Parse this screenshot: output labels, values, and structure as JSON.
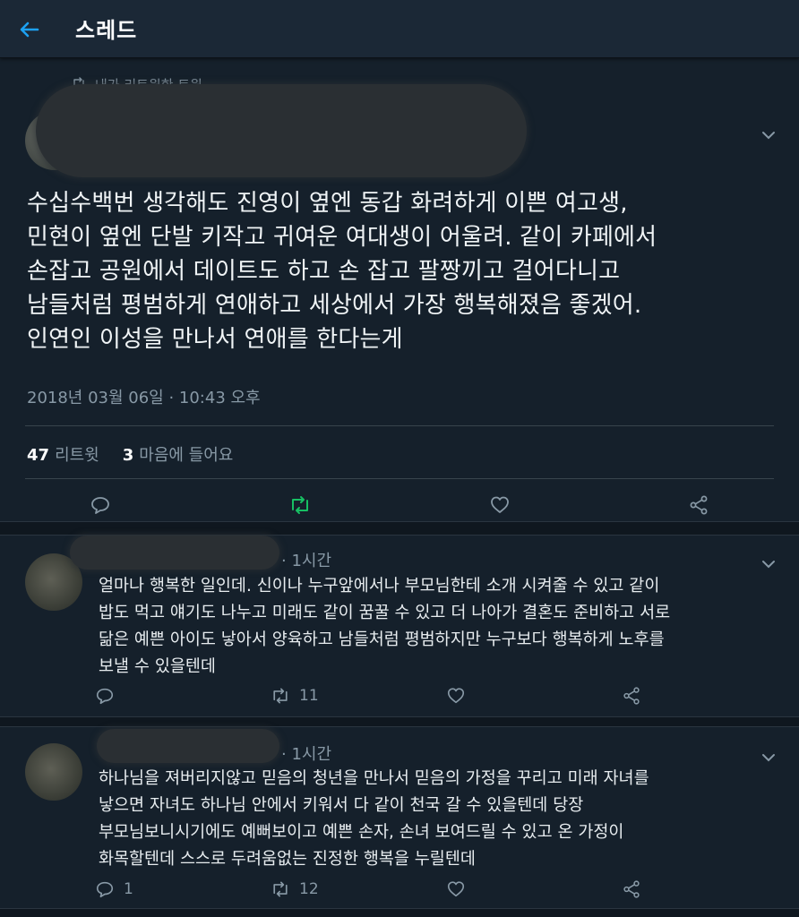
{
  "header": {
    "title": "스레드"
  },
  "retweet_note": "내가 리트윗한 트윗",
  "tweet": {
    "text": "수십수백번 생각해도 진영이 옆엔 동갑 화려하게 이쁜 여고생,\n민현이 옆엔 단발 키작고 귀여운 여대생이 어울려. 같이 카페에서\n손잡고 공원에서 데이트도 하고 손 잡고 팔짱끼고 걸어다니고\n남들처럼 평범하게 연애하고 세상에서 가장 행복해졌음 좋겠어.\n인연인 이성을 만나서 연애를 한다는게",
    "timestamp": "2018년 03월 06일 · 10:43 오후",
    "retweet_count": "47",
    "retweet_label": "리트윗",
    "like_count": "3",
    "like_label": "마음에 들어요"
  },
  "replies": [
    {
      "time": "· 1시간",
      "text": "얼마나 행복한 일인데. 신이나 누구앞에서나  부모님한테 소개 시켜줄 수 있고 같이\n밥도 먹고 얘기도 나누고 미래도 같이 꿈꿀 수 있고 더 나아가 결혼도 준비하고 서로\n닮은 예쁜 아이도 낳아서 양육하고 남들처럼 평범하지만 누구보다 행복하게 노후를\n보낼 수 있을텐데",
      "reply_count": "",
      "retweet_count": "11"
    },
    {
      "time": "· 1시간",
      "text": "하나님을 져버리지않고 믿음의 청년을 만나서 믿음의 가정을 꾸리고 미래 자녀를\n낳으면 자녀도 하나님 안에서 키워서 다 같이 천국 갈 수 있을텐데 당장\n부모님보니시기에도 예뻐보이고 예쁜 손자, 손녀 보여드릴 수 있고 온 가정이\n화목할텐데 스스로 두려움없는 진정한 행복을 누릴텐데",
      "reply_count": "1",
      "retweet_count": "12"
    }
  ],
  "colors": {
    "background": "#15202b",
    "accent": "#1da1f2",
    "retweet_active": "#17bf63",
    "muted": "#8899a6"
  },
  "icons": [
    "back-arrow-icon",
    "retweet-icon",
    "chevron-down-icon",
    "reply-icon",
    "like-icon",
    "share-icon"
  ]
}
